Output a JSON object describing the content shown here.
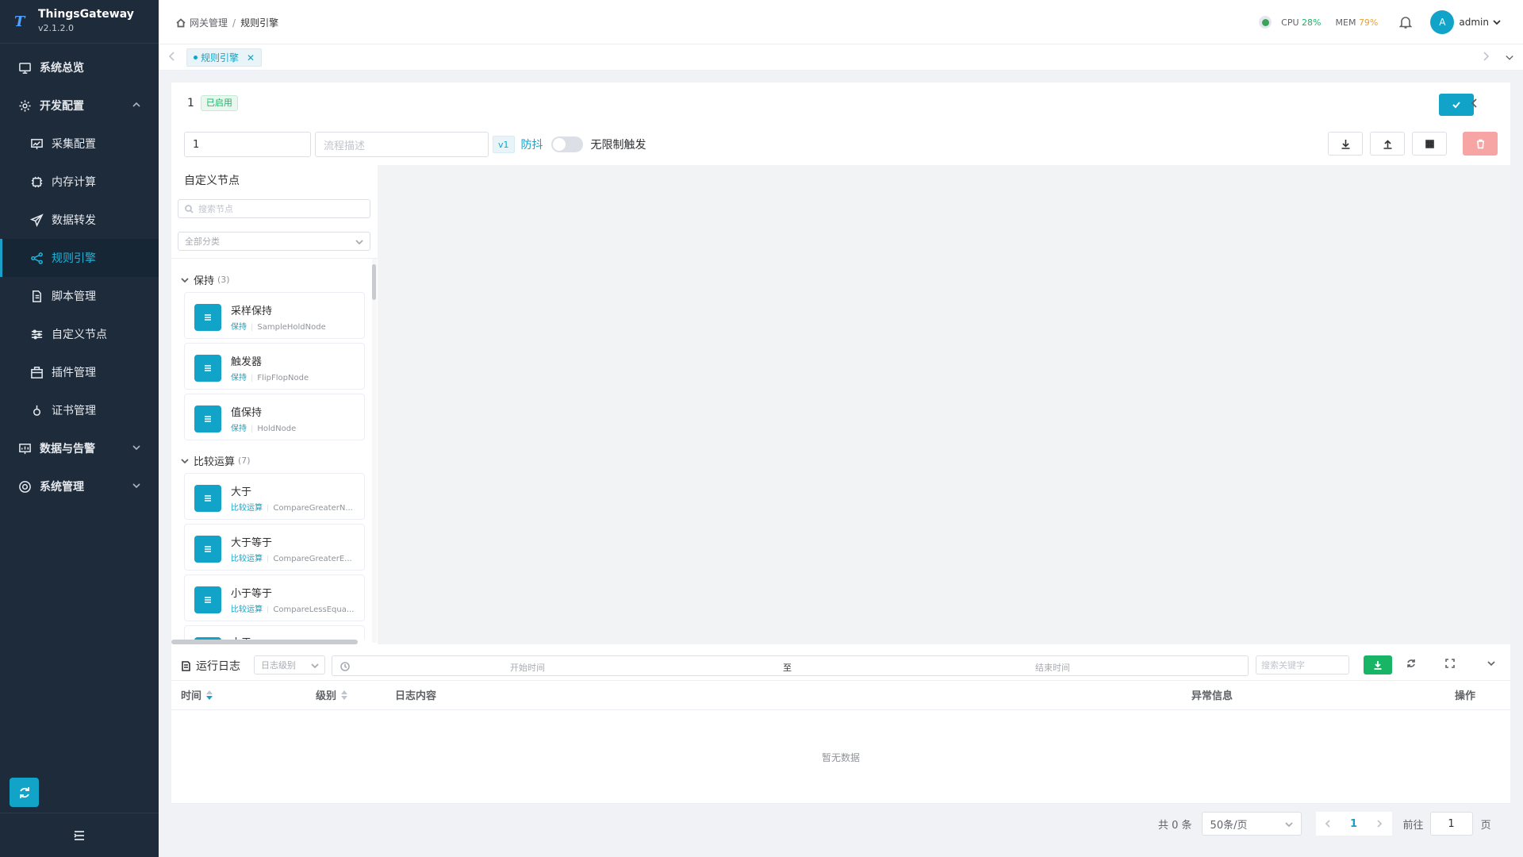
{
  "app": {
    "name": "ThingsGateway",
    "version": "v2.1.2.0",
    "logo_letter": "T"
  },
  "sidebar": {
    "items": [
      {
        "label": "系统总览",
        "icon": "monitor-icon",
        "level": "top"
      },
      {
        "label": "开发配置",
        "icon": "gear-icon",
        "level": "top",
        "expanded": true
      },
      {
        "label": "采集配置",
        "icon": "chart-board-icon",
        "level": "sub"
      },
      {
        "label": "内存计算",
        "icon": "chip-icon",
        "level": "sub"
      },
      {
        "label": "数据转发",
        "icon": "send-icon",
        "level": "sub"
      },
      {
        "label": "规则引擎",
        "icon": "share-icon",
        "level": "sub",
        "active": true
      },
      {
        "label": "脚本管理",
        "icon": "document-icon",
        "level": "sub"
      },
      {
        "label": "自定义节点",
        "icon": "sliders-icon",
        "level": "sub"
      },
      {
        "label": "插件管理",
        "icon": "package-icon",
        "level": "sub"
      },
      {
        "label": "证书管理",
        "icon": "certificate-icon",
        "level": "sub"
      },
      {
        "label": "数据与告警",
        "icon": "monitor-chart-icon",
        "level": "top",
        "expanded": false
      },
      {
        "label": "系统管理",
        "icon": "settings-icon",
        "level": "top",
        "expanded": false
      }
    ]
  },
  "header": {
    "breadcrumb": [
      "网关管理",
      "规则引擎"
    ],
    "cpu_label": "CPU",
    "cpu_value": "28%",
    "mem_label": "MEM",
    "mem_value": "79%",
    "user_initial": "A",
    "user_name": "admin"
  },
  "tabs": [
    {
      "label": "规则引擎",
      "active": true
    }
  ],
  "flow": {
    "id": "1",
    "status": "已启用",
    "name_value": "1",
    "desc_placeholder": "流程描述",
    "version": "v1",
    "debounce_label": "防抖",
    "unlimited_label": "无限制触发",
    "unlimited_on": false
  },
  "node_panel": {
    "title": "自定义节点",
    "search_placeholder": "搜索节点",
    "category_select": "全部分类",
    "groups": [
      {
        "name": "保持",
        "count": "(3)",
        "nodes": [
          {
            "name": "采样保持",
            "category": "保持",
            "type": "SampleHoldNode"
          },
          {
            "name": "触发器",
            "category": "保持",
            "type": "FlipFlopNode"
          },
          {
            "name": "值保持",
            "category": "保持",
            "type": "HoldNode"
          }
        ]
      },
      {
        "name": "比较运算",
        "count": "(7)",
        "nodes": [
          {
            "name": "大于",
            "category": "比较运算",
            "type": "CompareGreaterN..."
          },
          {
            "name": "大于等于",
            "category": "比较运算",
            "type": "CompareGreaterE..."
          },
          {
            "name": "小于等于",
            "category": "比较运算",
            "type": "CompareLessEqua..."
          },
          {
            "name": "小于",
            "category": "",
            "type": ""
          }
        ]
      }
    ]
  },
  "log": {
    "title": "运行日志",
    "level_placeholder": "日志级别",
    "start_placeholder": "开始时间",
    "range_separator": "至",
    "end_placeholder": "结束时间",
    "keyword_placeholder": "搜索关键字",
    "columns": [
      "时间",
      "级别",
      "日志内容",
      "异常信息",
      "操作"
    ],
    "empty_text": "暂无数据"
  },
  "pagination": {
    "total_text": "共 0 条",
    "page_size": "50条/页",
    "current_page": "1",
    "goto_label": "前往",
    "goto_value": "1",
    "page_unit": "页"
  },
  "colors": {
    "sidebar_bg": "#1d2b3a",
    "accent": "#11a3c8",
    "success": "#18b566",
    "warning": "#e6a23c",
    "danger_light": "#f7a4a4"
  }
}
